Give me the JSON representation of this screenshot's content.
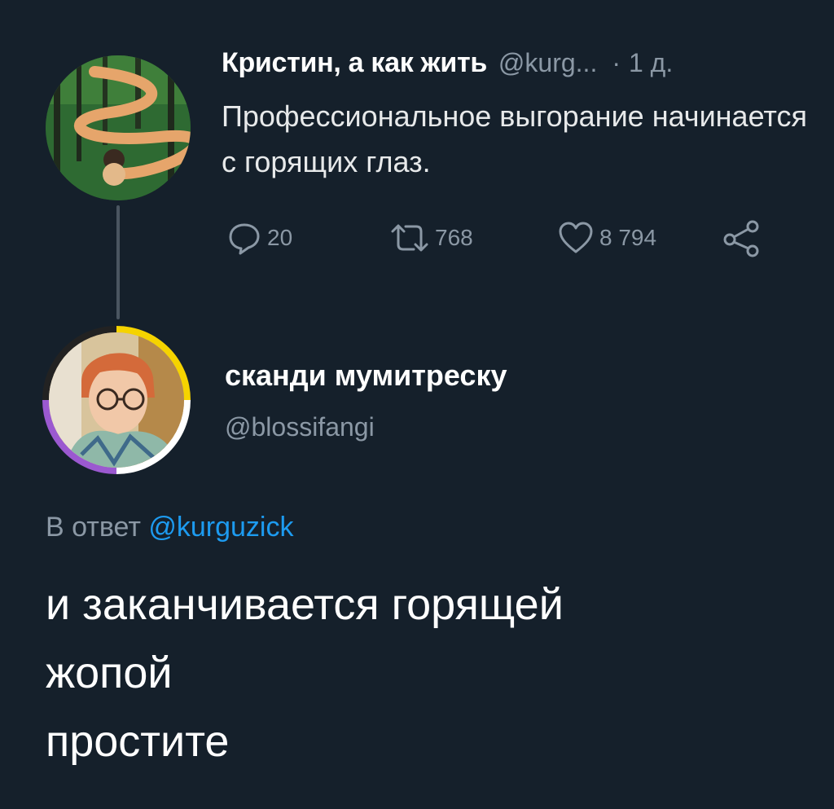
{
  "parent_tweet": {
    "author_name": "Кристин, а как жить",
    "author_handle": "@kurg...",
    "separator": "·",
    "time": "1 д.",
    "text": "Профессиональное выгорание начинается с горящих глаз.",
    "actions": {
      "reply": {
        "icon": "reply-icon",
        "count": "20"
      },
      "retweet": {
        "icon": "retweet-icon",
        "count": "768"
      },
      "like": {
        "icon": "heart-icon",
        "count": "8 794"
      },
      "share": {
        "icon": "share-icon"
      }
    }
  },
  "reply_tweet": {
    "author_name": "сканди мумитреску",
    "author_handle": "@blossifangi",
    "replying_to_label": "В ответ",
    "replying_to_mention": "@kurguzick",
    "text_lines": [
      "и заканчивается горящей",
      "жопой",
      "простите"
    ]
  },
  "colors": {
    "background": "#15202b",
    "secondary_text": "#8b98a5",
    "link": "#1d9bf0",
    "thread_line": "#4a5560"
  }
}
